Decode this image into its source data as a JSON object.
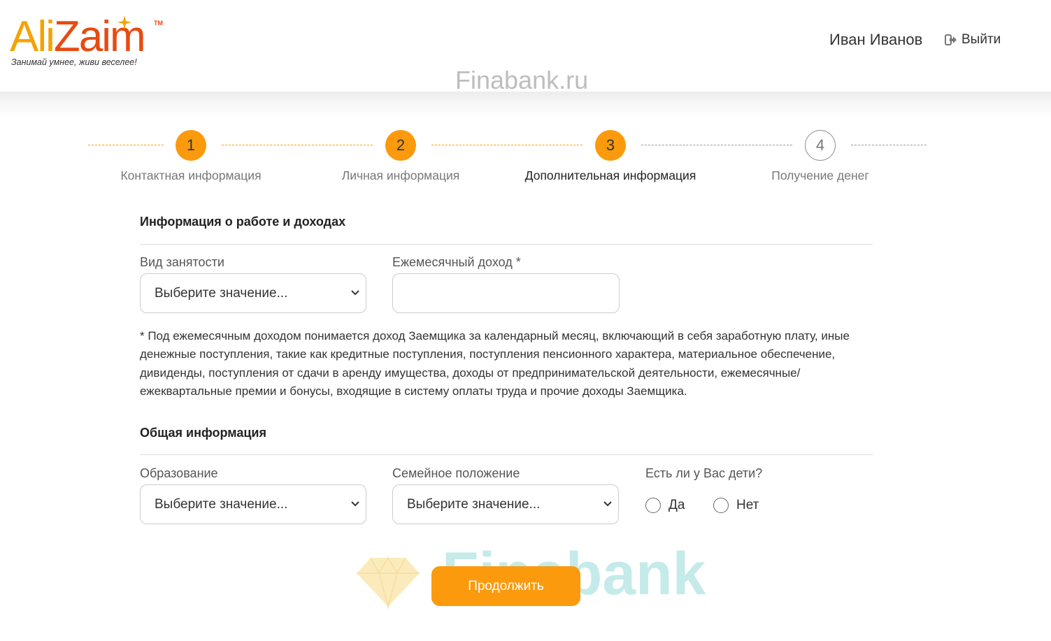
{
  "brand": {
    "logo_ali": "Ali",
    "logo_zaim": "Zaim",
    "logo_tm": "TM",
    "slogan": "Занимай умнее, живи веселее!",
    "colors": {
      "accent": "#fb9a0c",
      "logo_orange": "#f5a300",
      "logo_red": "#e84a10"
    }
  },
  "header": {
    "user_name": "Иван Иванов",
    "logout_label": "Выйти",
    "logout_icon": "sign-out-icon"
  },
  "watermark": {
    "top_text": "Finabank.ru",
    "bottom_text": "Finabank"
  },
  "stepper": {
    "steps": [
      {
        "number": "1",
        "label": "Контактная информация",
        "state": "completed"
      },
      {
        "number": "2",
        "label": "Личная информация",
        "state": "completed"
      },
      {
        "number": "3",
        "label": "Дополнительная информация",
        "state": "current"
      },
      {
        "number": "4",
        "label": "Получение денег",
        "state": "upcoming"
      }
    ]
  },
  "work_section": {
    "title": "Информация о работе и доходах",
    "employment": {
      "label": "Вид занятости",
      "value": "Выберите значение..."
    },
    "income": {
      "label": "Ежемесячный доход *",
      "value": "",
      "placeholder": ""
    },
    "note": "* Под ежемесячным доходом понимается доход Заемщика за календарный месяц, включающий в себя заработную плату, иные денежные поступления, такие как кредитные поступления, поступления пенсионного характера, материальное обеспечение, дивиденды, поступления от сдачи в аренду имущества, доходы от предпринимательской деятельности, ежемесячные/ежеквартальные премии и бонусы, входящие в систему оплаты труда и прочие доходы Заемщика."
  },
  "general_section": {
    "title": "Общая информация",
    "education": {
      "label": "Образование",
      "value": "Выберите значение..."
    },
    "marital": {
      "label": "Семейное положение",
      "value": "Выберите значение..."
    },
    "children": {
      "label": "Есть ли у Вас дети?",
      "yes": "Да",
      "no": "Нет",
      "selected": null
    }
  },
  "submit_label": "Продолжить"
}
